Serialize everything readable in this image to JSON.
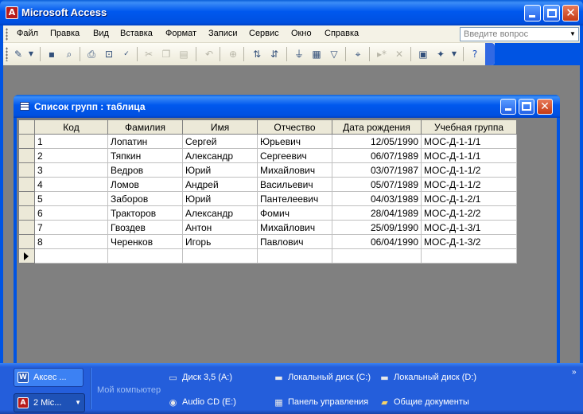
{
  "app": {
    "title": "Microsoft Access",
    "icon_letter": "A"
  },
  "menu": {
    "items": [
      "Файл",
      "Правка",
      "Вид",
      "Вставка",
      "Формат",
      "Записи",
      "Сервис",
      "Окно",
      "Справка"
    ],
    "help_placeholder": "Введите вопрос"
  },
  "toolbar": {
    "buttons": [
      "design-view-icon",
      "save-icon",
      "search-file-icon",
      "print-icon",
      "print-preview-icon",
      "spelling-icon",
      "cut-icon",
      "copy-icon",
      "paste-icon",
      "undo-icon",
      "insert-hyperlink-icon",
      "sort-ascending-icon",
      "sort-descending-icon",
      "filter-by-selection-icon",
      "filter-by-form-icon",
      "apply-filter-icon",
      "find-icon",
      "new-record-icon",
      "delete-record-icon",
      "properties-icon",
      "new-object-icon",
      "help-icon"
    ]
  },
  "table_window": {
    "title": "Список групп : таблица",
    "columns": [
      "Код",
      "Фамилия",
      "Имя",
      "Отчество",
      "Дата рождения",
      "Учебная группа"
    ],
    "rows": [
      [
        "1",
        "Лопатин",
        "Сергей",
        "Юрьевич",
        "12/05/1990",
        "МОС-Д-1-1/1"
      ],
      [
        "2",
        "Тяпкин",
        "Александр",
        "Сергеевич",
        "06/07/1989",
        "МОС-Д-1-1/1"
      ],
      [
        "3",
        "Ведров",
        "Юрий",
        "Михайлович",
        "03/07/1987",
        "МОС-Д-1-1/2"
      ],
      [
        "4",
        "Ломов",
        "Андрей",
        "Васильевич",
        "05/07/1989",
        "МОС-Д-1-1/2"
      ],
      [
        "5",
        "Заборов",
        "Юрий",
        "Пантелеевич",
        "04/03/1989",
        "МОС-Д-1-2/1"
      ],
      [
        "6",
        "Тракторов",
        "Александр",
        "Фомич",
        "28/04/1989",
        "МОС-Д-1-2/2"
      ],
      [
        "7",
        "Гвоздев",
        "Антон",
        "Михайлович",
        "25/09/1990",
        "МОС-Д-1-3/1"
      ],
      [
        "8",
        "Черенков",
        "Игорь",
        "Павлович",
        "06/04/1990",
        "МОС-Д-1-3/2"
      ]
    ]
  },
  "taskbar": {
    "buttons": [
      {
        "label": "Аксес ...",
        "icon": "word-document-icon"
      },
      {
        "label": "2 Mic...",
        "icon": "access-icon"
      }
    ],
    "my_computer": "Мой компьютер",
    "links": [
      {
        "label": "Диск 3,5 (A:)",
        "icon": "floppy-drive-icon"
      },
      {
        "label": "Локальный диск (C:)",
        "icon": "hard-drive-icon"
      },
      {
        "label": "Локальный диск (D:)",
        "icon": "hard-drive-icon"
      },
      {
        "label": "Audio CD (E:)",
        "icon": "cd-drive-icon"
      },
      {
        "label": "Панель управления",
        "icon": "control-panel-icon"
      },
      {
        "label": "Общие документы",
        "icon": "shared-folder-icon"
      }
    ]
  },
  "colors": {
    "title_bar": "#0054e3",
    "workspace": "#808080",
    "taskbar": "#245edb",
    "close_button": "#c53a14"
  }
}
